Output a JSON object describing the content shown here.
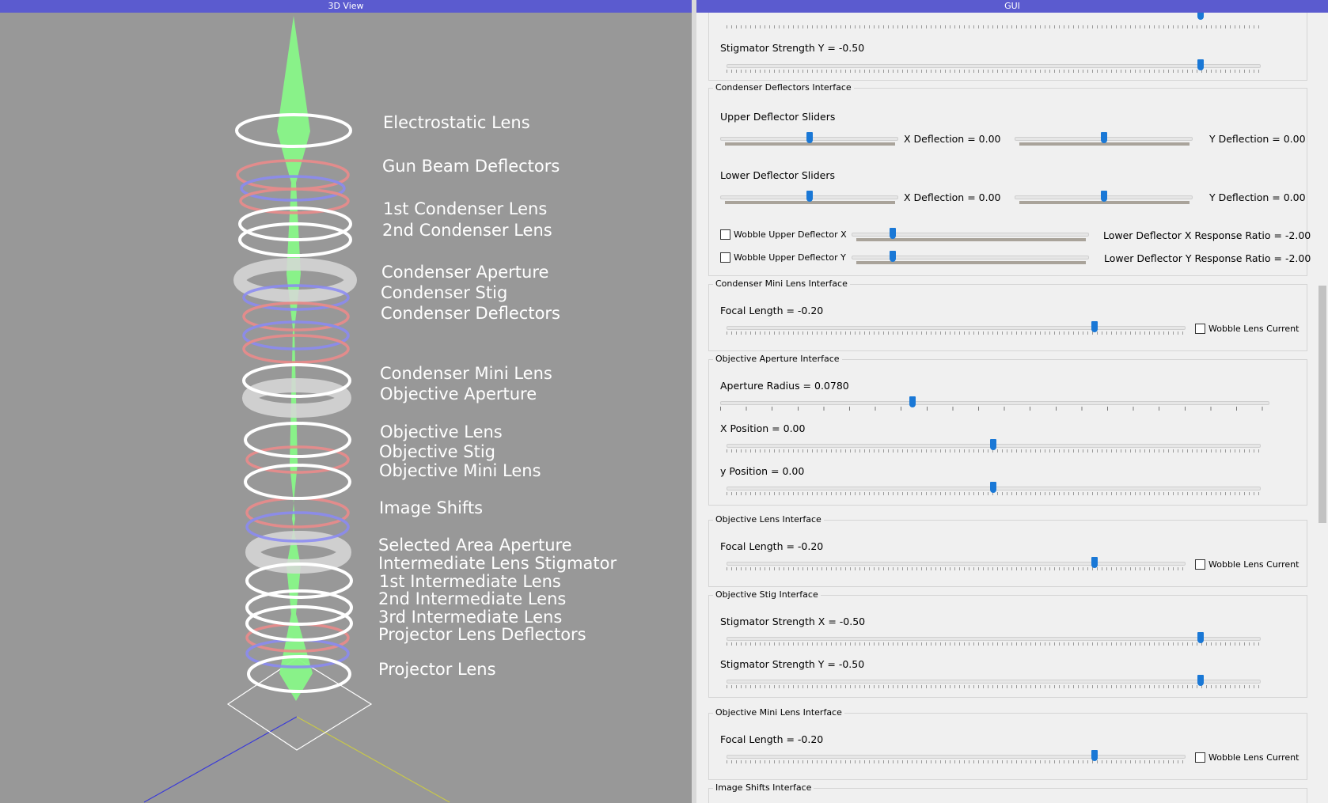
{
  "view3d": {
    "title": "3D View",
    "labels": [
      "Electrostatic Lens",
      "Gun Beam Deflectors",
      "1st Condenser Lens",
      "2nd Condenser Lens",
      "Condenser Aperture",
      "Condenser Stig",
      "Condenser Deflectors",
      "Condenser Mini Lens",
      "Objective Aperture",
      "Objective Lens",
      "Objective Stig",
      "Objective Mini Lens",
      "Image Shifts",
      "Selected Area Aperture",
      "Intermediate Lens Stigmator",
      "1st Intermediate Lens",
      "2nd Intermediate Lens",
      "3rd Intermediate Lens",
      "Projector Lens Deflectors",
      "Projector Lens"
    ]
  },
  "gui": {
    "title": "GUI",
    "top_partial": {
      "label": "Stigmator Strength Y = -0.50",
      "value": -0.5
    },
    "condenser_deflectors": {
      "title": "Condenser Deflectors Interface",
      "upper_title": "Upper Deflector Sliders",
      "upper_x": "X Deflection = 0.00",
      "upper_y": "Y Deflection = 0.00",
      "lower_title": "Lower Deflector Sliders",
      "lower_x": "X Deflection = 0.00",
      "lower_y": "Y Deflection = 0.00",
      "wobble_x": "Wobble Upper Deflector X",
      "wobble_y": "Wobble Upper Deflector Y",
      "ratio_x": "Lower Deflector X Response Ratio = -2.00",
      "ratio_y": "Lower Deflector Y Response Ratio = -2.00"
    },
    "condenser_mini": {
      "title": "Condenser Mini Lens Interface",
      "focal": "Focal Length = -0.20",
      "wobble": "Wobble Lens Current"
    },
    "objective_aperture": {
      "title": "Objective Aperture Interface",
      "radius": "Aperture Radius = 0.0780",
      "x": "X Position = 0.00",
      "y": "y Position = 0.00"
    },
    "objective_lens": {
      "title": "Objective Lens Interface",
      "focal": "Focal Length = -0.20",
      "wobble": "Wobble Lens Current"
    },
    "objective_stig": {
      "title": "Objective Stig Interface",
      "x": "Stigmator Strength X = -0.50",
      "y": "Stigmator Strength Y = -0.50"
    },
    "objective_mini": {
      "title": "Objective Mini Lens Interface",
      "focal": "Focal Length = -0.20",
      "wobble": "Wobble Lens Current"
    },
    "image_shifts": {
      "title": "Image Shifts Interface"
    }
  },
  "colors": {
    "beam": "#88f788",
    "title_bar": "#5b5bcf",
    "handle": "#1a78d6",
    "ring_red": "#f08a8a",
    "ring_blue": "#8a8af5"
  }
}
